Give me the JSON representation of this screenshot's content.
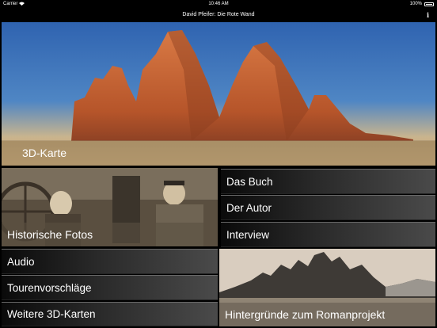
{
  "status_bar": {
    "carrier": "Carrier",
    "time": "10:46 AM",
    "battery": "100%"
  },
  "nav": {
    "title": "David Pfeifer: Die Rote Wand",
    "info_glyph": "i"
  },
  "hero": {
    "label": "3D-Karte"
  },
  "tiles": [
    {
      "label": "Historische Fotos"
    },
    {
      "label": "Das Buch"
    },
    {
      "label": "Der Autor"
    },
    {
      "label": "Interview"
    },
    {
      "label": "Audio"
    },
    {
      "label": "Tourenvorschläge"
    },
    {
      "label": "Weitere 3D-Karten"
    },
    {
      "label": "Hintergründe zum Romanprojekt"
    }
  ],
  "colors": {
    "background": "#000000",
    "sky": "#3d6fb3",
    "rock_lit": "#c8602f"
  },
  "icons": [
    "wifi-icon",
    "battery-icon",
    "info-icon"
  ]
}
